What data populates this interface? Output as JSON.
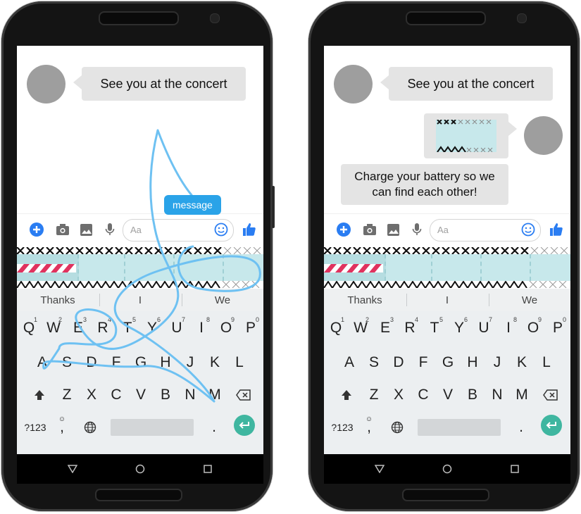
{
  "phones": [
    {
      "id": "left",
      "chat": {
        "incoming_1": "See you at the concert",
        "gesture_suggestion": "message"
      },
      "composer": {
        "placeholder": "Aa"
      },
      "suggestions": [
        "Thanks",
        "I",
        "We"
      ],
      "keyboard": {
        "row1": [
          [
            "Q",
            "1"
          ],
          [
            "W",
            "2"
          ],
          [
            "E",
            "3"
          ],
          [
            "R",
            "4"
          ],
          [
            "T",
            "5"
          ],
          [
            "Y",
            "6"
          ],
          [
            "U",
            "7"
          ],
          [
            "I",
            "8"
          ],
          [
            "O",
            "9"
          ],
          [
            "P",
            "0"
          ]
        ],
        "row2": [
          "A",
          "S",
          "D",
          "F",
          "G",
          "H",
          "J",
          "K",
          "L"
        ],
        "row3": [
          "Z",
          "X",
          "C",
          "V",
          "B",
          "N",
          "M"
        ],
        "symbols_key": "?123",
        "comma_key": ",",
        "period_key": "."
      }
    },
    {
      "id": "right",
      "chat": {
        "incoming_1": "See you at the concert",
        "incoming_2": "Charge your battery so we can find each other!"
      },
      "composer": {
        "placeholder": "Aa"
      },
      "suggestions": [
        "Thanks",
        "I",
        "We"
      ],
      "keyboard": {
        "row1": [
          [
            "Q",
            "1"
          ],
          [
            "W",
            "2"
          ],
          [
            "E",
            "3"
          ],
          [
            "R",
            "4"
          ],
          [
            "T",
            "5"
          ],
          [
            "Y",
            "6"
          ],
          [
            "U",
            "7"
          ],
          [
            "I",
            "8"
          ],
          [
            "O",
            "9"
          ],
          [
            "P",
            "0"
          ]
        ],
        "row2": [
          "A",
          "S",
          "D",
          "F",
          "G",
          "H",
          "J",
          "K",
          "L"
        ],
        "row3": [
          "Z",
          "X",
          "C",
          "V",
          "B",
          "N",
          "M"
        ],
        "symbols_key": "?123",
        "comma_key": ",",
        "period_key": "."
      }
    }
  ],
  "colors": {
    "accent_blue": "#2a7df2",
    "gesture_trail": "#6ec1f2",
    "enter_key": "#3fb6a0",
    "sticker_bg": "#c7e8eb",
    "sticker_stripe": "#e0325e"
  },
  "icons": [
    "plus-circle-icon",
    "camera-icon",
    "image-icon",
    "mic-icon",
    "emoji-icon",
    "thumbs-up-icon",
    "shift-icon",
    "backspace-icon",
    "globe-icon",
    "enter-icon",
    "back-icon",
    "home-icon",
    "recents-icon"
  ]
}
